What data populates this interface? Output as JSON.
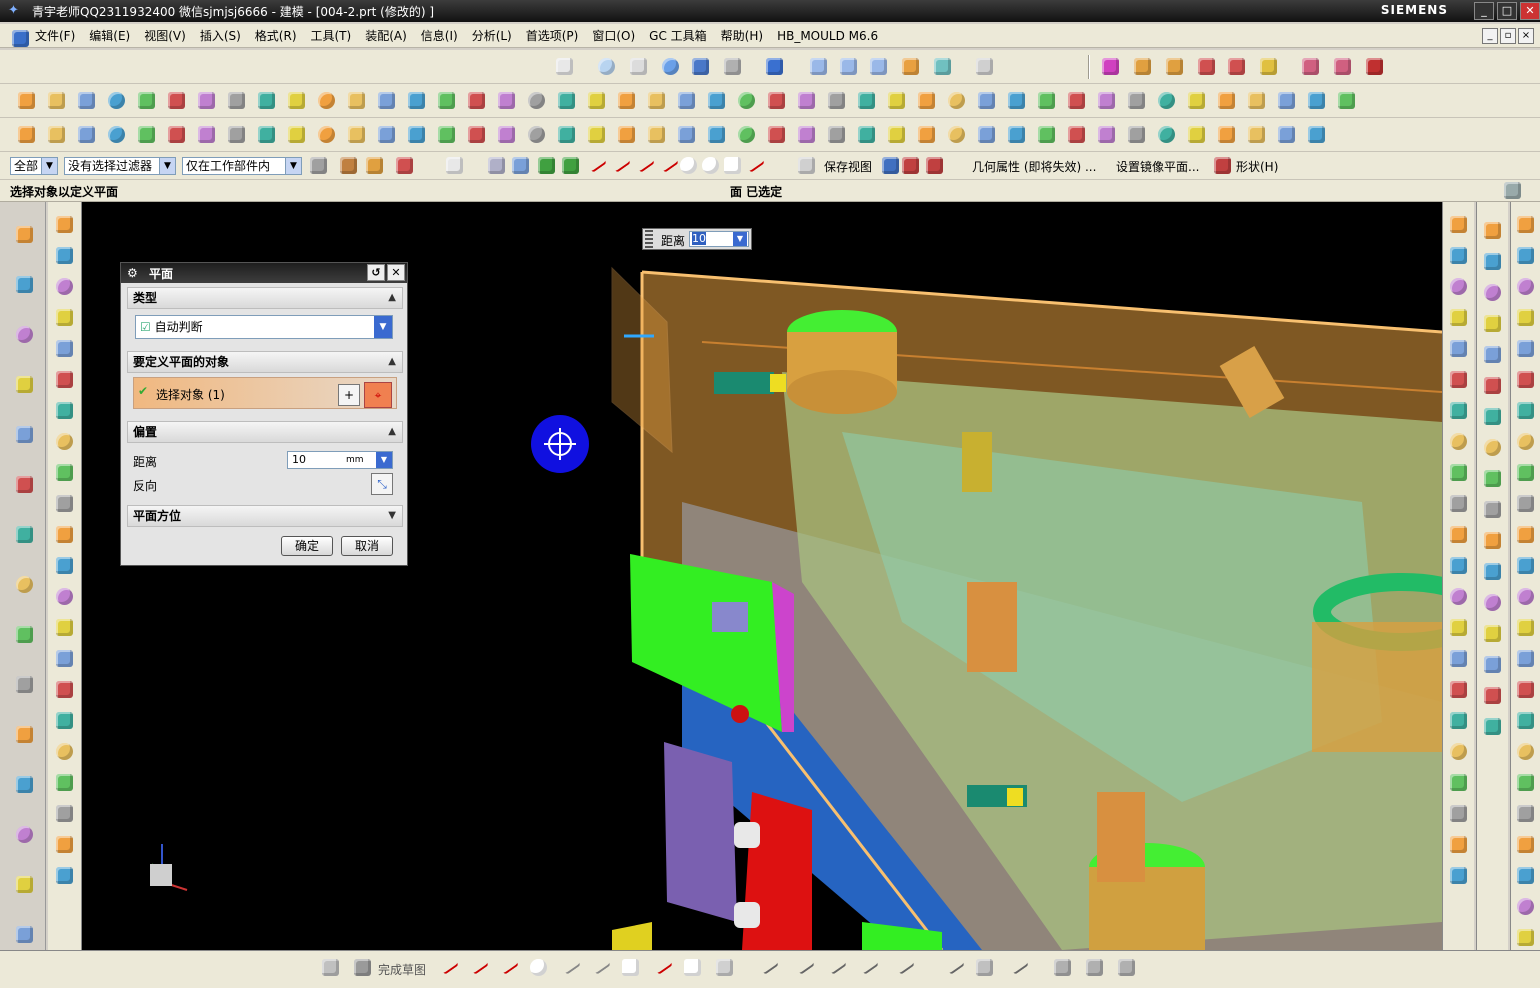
{
  "window": {
    "title": "青宇老师QQ2311932400 微信sjmjsj6666 - 建模 - [004-2.prt  (修改的) ]",
    "brand": "SIEMENS",
    "controls": [
      "_",
      "□",
      "✕"
    ]
  },
  "menu": [
    "文件(F)",
    "编辑(E)",
    "视图(V)",
    "插入(S)",
    "格式(R)",
    "工具(T)",
    "装配(A)",
    "信息(I)",
    "分析(L)",
    "首选项(P)",
    "窗口(O)",
    "GC 工具箱",
    "帮助(H)",
    "HB_MOULD M6.6"
  ],
  "selection_bar": {
    "filter_all": "全部",
    "filter_none": "没有选择过滤器",
    "scope": "仅在工作部件内",
    "save_view": "保存视图",
    "geom_props": "几何属性 (即将失效) ...",
    "mirror_plane": "设置镜像平面...",
    "shape": "形状(H)"
  },
  "cue": {
    "prompt": "选择对象以定义平面",
    "status": "面 已选定"
  },
  "distance_popup": {
    "label": "距离",
    "value": "10"
  },
  "dialog": {
    "title": "平面",
    "section_type": "类型",
    "type_value": "自动判断",
    "section_objects": "要定义平面的对象",
    "select_objects": "选择对象 (1)",
    "section_offset": "偏置",
    "distance_label": "距离",
    "distance_value": "10",
    "distance_unit": "mm",
    "reverse_label": "反向",
    "section_orientation": "平面方位",
    "ok": "确定",
    "cancel": "取消"
  },
  "bottom": {
    "finish_sketch": "完成草图"
  },
  "colors": {
    "viewport_bg": "#000000",
    "accent_orange": "#f0a040",
    "highlight_green": "#33ee22"
  }
}
